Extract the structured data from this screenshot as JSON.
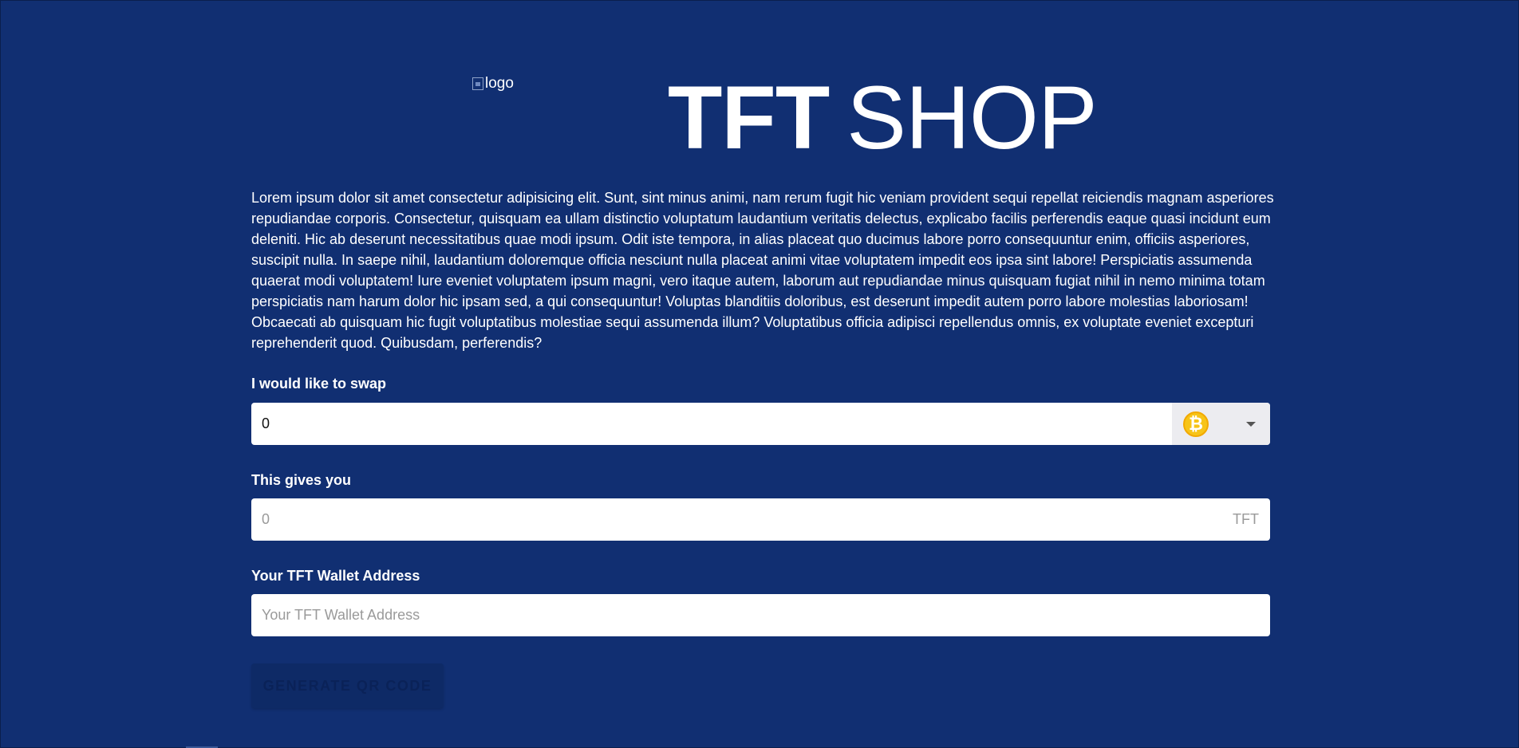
{
  "header": {
    "logo_alt": "logo",
    "title_bold": "TFT",
    "title_light": "SHOP"
  },
  "intro": {
    "text": "Lorem ipsum dolor sit amet consectetur adipisicing elit. Sunt, sint minus animi, nam rerum fugit hic veniam provident sequi repellat reiciendis magnam asperiores repudiandae corporis. Consectetur, quisquam ea ullam distinctio voluptatum laudantium veritatis delectus, explicabo facilis perferendis eaque quasi incidunt eum deleniti. Hic ab deserunt necessitatibus quae modi ipsum. Odit iste tempora, in alias placeat quo ducimus labore porro consequuntur enim, officiis asperiores, suscipit nulla. In saepe nihil, laudantium doloremque officia nesciunt nulla placeat animi vitae voluptatem impedit eos ipsa sint labore! Perspiciatis assumenda quaerat modi voluptatem! Iure eveniet voluptatem ipsum magni, vero itaque autem, laborum aut repudiandae minus quisquam fugiat nihil in nemo minima totam perspiciatis nam harum dolor hic ipsam sed, a qui consequuntur! Voluptas blanditiis doloribus, est deserunt impedit autem porro labore molestias laboriosam! Obcaecati ab quisquam hic fugit voluptatibus molestiae sequi assumenda illum? Voluptatibus officia adipisci repellendus omnis, ex voluptate eveniet excepturi reprehenderit quod. Quibusdam, perferendis?"
  },
  "swap": {
    "label": "I would like to swap",
    "value": "0",
    "currency_icon": "bitcoin-icon",
    "currency_symbol": "₿"
  },
  "gives": {
    "label": "This gives you",
    "placeholder": "0",
    "suffix": "TFT"
  },
  "wallet": {
    "label": "Your TFT Wallet Address",
    "placeholder": "Your TFT Wallet Address"
  },
  "actions": {
    "generate_label": "Generate QR Code"
  },
  "colors": {
    "background": "#112f72",
    "bitcoin": "#f7c418"
  }
}
